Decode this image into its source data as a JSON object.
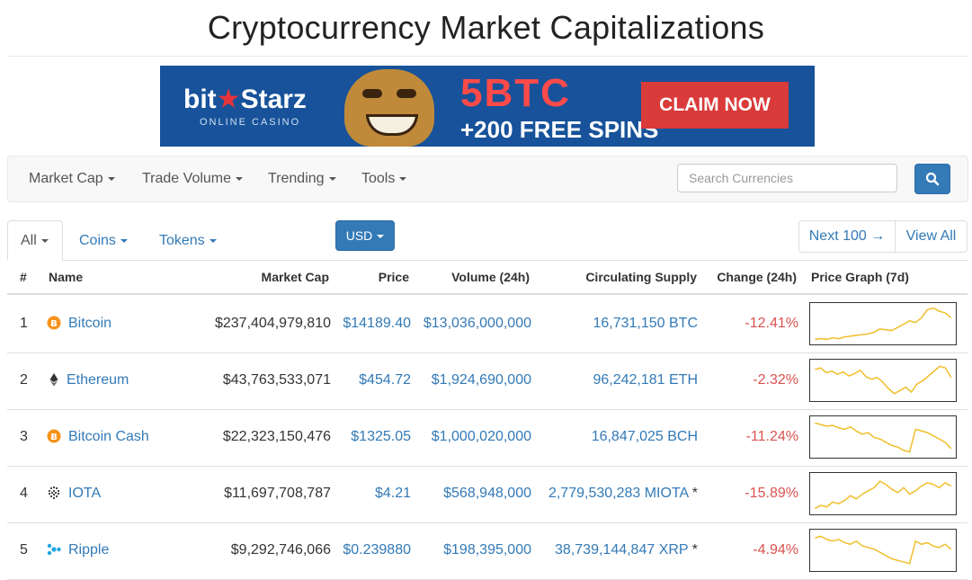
{
  "page": {
    "title": "Cryptocurrency Market Capitalizations"
  },
  "banner": {
    "brand_a": "bit",
    "brand_b": "Starz",
    "brand_sub": "ONLINE CASINO",
    "offer": "5BTC",
    "spins": "+200 FREE SPINS",
    "cta": "CLAIM NOW"
  },
  "navbar": {
    "items": [
      "Market Cap",
      "Trade Volume",
      "Trending",
      "Tools"
    ],
    "search_placeholder": "Search Currencies"
  },
  "filters": {
    "all": "All",
    "coins": "Coins",
    "tokens": "Tokens",
    "currency": "USD",
    "next": "Next 100 →",
    "view_all": "View All"
  },
  "table": {
    "headers": [
      "#",
      "Name",
      "Market Cap",
      "Price",
      "Volume (24h)",
      "Circulating Supply",
      "Change (24h)",
      "Price Graph (7d)"
    ],
    "rows": [
      {
        "rank": "1",
        "name": "Bitcoin",
        "icon": "bitcoin-icon",
        "market_cap": "$237,404,979,810",
        "price": "$14189.40",
        "volume": "$13,036,000,000",
        "supply": "16,731,150 BTC",
        "supply_note": "",
        "change": "-12.41%",
        "spark": [
          3,
          4,
          3,
          5,
          4,
          6,
          7,
          8,
          9,
          10,
          12,
          16,
          15,
          14,
          18,
          22,
          26,
          24,
          30,
          40,
          42,
          38,
          36,
          30
        ],
        "spark_ref": [
          0,
          45
        ]
      },
      {
        "rank": "2",
        "name": "Ethereum",
        "icon": "ethereum-icon",
        "market_cap": "$43,763,533,071",
        "price": "$454.72",
        "volume": "$1,924,690,000",
        "supply": "96,242,181 ETH",
        "supply_note": "",
        "change": "-2.32%",
        "spark": [
          36,
          38,
          32,
          34,
          30,
          33,
          28,
          31,
          35,
          27,
          24,
          26,
          20,
          12,
          6,
          10,
          14,
          8,
          18,
          22,
          28,
          34,
          40,
          38,
          26
        ],
        "spark_ref": [
          0,
          45
        ]
      },
      {
        "rank": "3",
        "name": "Bitcoin Cash",
        "icon": "bitcoin-cash-icon",
        "market_cap": "$22,323,150,476",
        "price": "$1325.05",
        "volume": "$1,000,020,000",
        "supply": "16,847,025 BCH",
        "supply_note": "",
        "change": "-11.24%",
        "spark": [
          40,
          38,
          36,
          37,
          34,
          32,
          35,
          30,
          26,
          28,
          22,
          20,
          16,
          12,
          10,
          6,
          4,
          32,
          30,
          28,
          24,
          20,
          16,
          8
        ],
        "spark_ref": [
          0,
          45
        ]
      },
      {
        "rank": "4",
        "name": "IOTA",
        "icon": "iota-icon",
        "market_cap": "$11,697,708,787",
        "price": "$4.21",
        "volume": "$568,948,000",
        "supply": "2,779,530,283 MIOTA",
        "supply_note": "*",
        "change": "-15.89%",
        "spark": [
          4,
          8,
          6,
          12,
          10,
          14,
          20,
          16,
          22,
          26,
          30,
          38,
          34,
          28,
          24,
          30,
          22,
          26,
          32,
          36,
          34,
          30,
          36,
          32
        ],
        "spark_ref": [
          0,
          45
        ]
      },
      {
        "rank": "5",
        "name": "Ripple",
        "icon": "ripple-icon",
        "market_cap": "$9,292,746,066",
        "price": "$0.239880",
        "volume": "$198,395,000",
        "supply": "38,739,144,847 XRP",
        "supply_note": "*",
        "change": "-4.94%",
        "spark": [
          38,
          40,
          36,
          34,
          36,
          32,
          30,
          34,
          28,
          26,
          24,
          20,
          16,
          12,
          10,
          8,
          6,
          34,
          30,
          32,
          28,
          26,
          30,
          24
        ],
        "spark_ref": [
          0,
          45
        ]
      }
    ]
  },
  "colors": {
    "link": "#337ab7",
    "negative": "#d9534f",
    "spark": "#f0c030",
    "banner_bg": "#17529a"
  }
}
